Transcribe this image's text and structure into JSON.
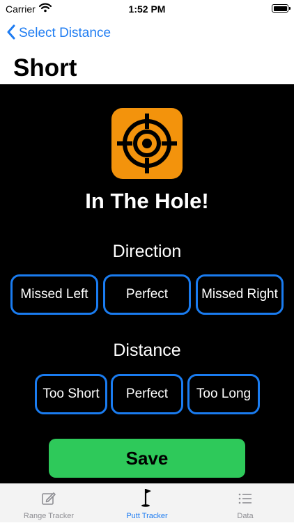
{
  "status_bar": {
    "carrier": "Carrier",
    "time": "1:52 PM"
  },
  "nav": {
    "back_label": "Select Distance",
    "title": "Short"
  },
  "result": {
    "text": "In The Hole!",
    "icon": "target-icon"
  },
  "direction": {
    "heading": "Direction",
    "options": [
      "Missed Left",
      "Perfect",
      "Missed Right"
    ]
  },
  "distance": {
    "heading": "Distance",
    "options": [
      "Too Short",
      "Perfect",
      "Too Long"
    ]
  },
  "save_label": "Save",
  "tabs": [
    {
      "label": "Range Tracker",
      "icon": "edit-icon",
      "active": false
    },
    {
      "label": "Putt Tracker",
      "icon": "golf-flag-icon",
      "active": true
    },
    {
      "label": "Data",
      "icon": "list-icon",
      "active": false
    }
  ],
  "colors": {
    "accent": "#1e7cf2",
    "button_border": "#1a7cf0",
    "save": "#2ec95a",
    "icon_bg": "#f3930c"
  }
}
